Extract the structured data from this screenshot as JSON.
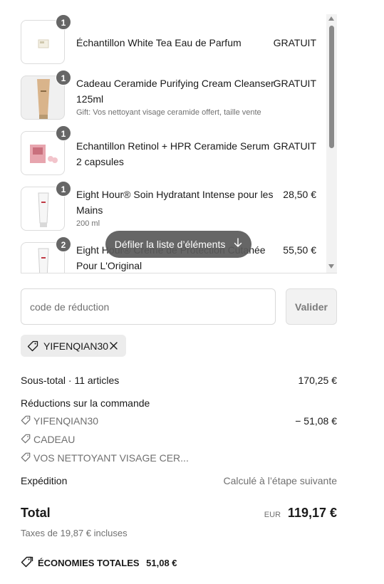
{
  "items": [
    {
      "qty": "1",
      "name": "Échantillon White Tea Eau de Parfum",
      "sub": "",
      "price": "GRATUIT",
      "thumb_icon": "perfume-sample-thumbnail"
    },
    {
      "qty": "1",
      "name": "Cadeau Ceramide Purifying Cream Cleanser 125ml",
      "sub": "Gift: Vos nettoyant visage ceramide offert, taille vente",
      "price": "GRATUIT",
      "thumb_icon": "cleanser-tube-thumbnail"
    },
    {
      "qty": "1",
      "name": "Echantillon Retinol + HPR Ceramide Serum 2 capsules",
      "sub": "",
      "price": "GRATUIT",
      "thumb_icon": "serum-capsules-thumbnail"
    },
    {
      "qty": "1",
      "name": "Eight Hour® Soin Hydratant Intense pour les Mains",
      "sub": "200 ml",
      "price": "28,50 €",
      "thumb_icon": "hand-cream-tube-thumbnail"
    },
    {
      "qty": "2",
      "name": "Eight Hour® Crème de Protection Cutanée Pour L'Original",
      "sub": "",
      "price": "55,50 €",
      "thumb_icon": "cream-tube-thumbnail"
    }
  ],
  "scroll_hint": {
    "label": "Défiler la liste d’éléments",
    "icon": "arrow-down-icon"
  },
  "discount": {
    "placeholder": "code de réduction",
    "button_label": "Valider"
  },
  "applied_code": {
    "label": "YIFENQIAN30",
    "icon": "tag-icon",
    "remove_icon": "close-icon"
  },
  "summary": {
    "subtotal_label": "Sous-total · 11 articles",
    "subtotal_value": "170,25 €",
    "order_discounts_label": "Réductions sur la commande",
    "discounts": [
      {
        "label": "YIFENQIAN30",
        "value": "− 51,08 €"
      },
      {
        "label": "CADEAU",
        "value": ""
      },
      {
        "label": "VOS NETTOYANT VISAGE CER...",
        "value": ""
      }
    ],
    "shipping_label": "Expédition",
    "shipping_value": "Calculé à l’étape suivante",
    "total_label": "Total",
    "currency": "EUR",
    "total_value": "119,17 €",
    "taxes_label": "Taxes de 19,87 € incluses",
    "savings_label": "ÉCONOMIES TOTALES",
    "savings_value": "51,08 €"
  },
  "colors": {
    "badge": "#666666",
    "text": "#1a1a1a",
    "muted": "#707070",
    "chip_bg": "#ececec"
  }
}
